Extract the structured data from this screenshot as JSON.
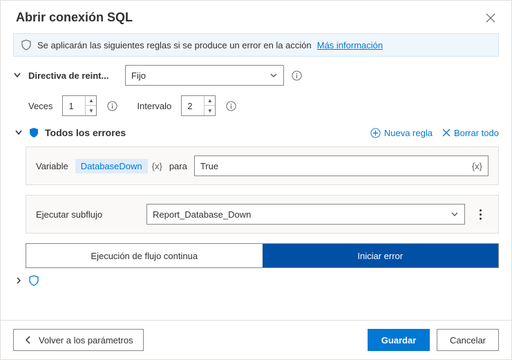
{
  "header": {
    "title": "Abrir conexión SQL"
  },
  "info": {
    "text": "Se aplicarán las siguientes reglas si se produce un error en la acción",
    "link": "Más información"
  },
  "retry": {
    "label": "Directiva de reint...",
    "policy": "Fijo",
    "times_label": "Veces",
    "times_value": "1",
    "interval_label": "Intervalo",
    "interval_value": "2"
  },
  "errors": {
    "title": "Todos los errores",
    "new_rule": "Nueva regla",
    "clear_all": "Borrar todo"
  },
  "rule1": {
    "variable_label": "Variable",
    "variable_name": "DatabaseDown",
    "para": "para",
    "value": "True"
  },
  "rule2": {
    "label": "Ejecutar subflujo",
    "value": "Report_Database_Down"
  },
  "flow": {
    "continue": "Ejecución de flujo continua",
    "throw": "Iniciar error"
  },
  "footer": {
    "back": "Volver a los parámetros",
    "save": "Guardar",
    "cancel": "Cancelar"
  }
}
